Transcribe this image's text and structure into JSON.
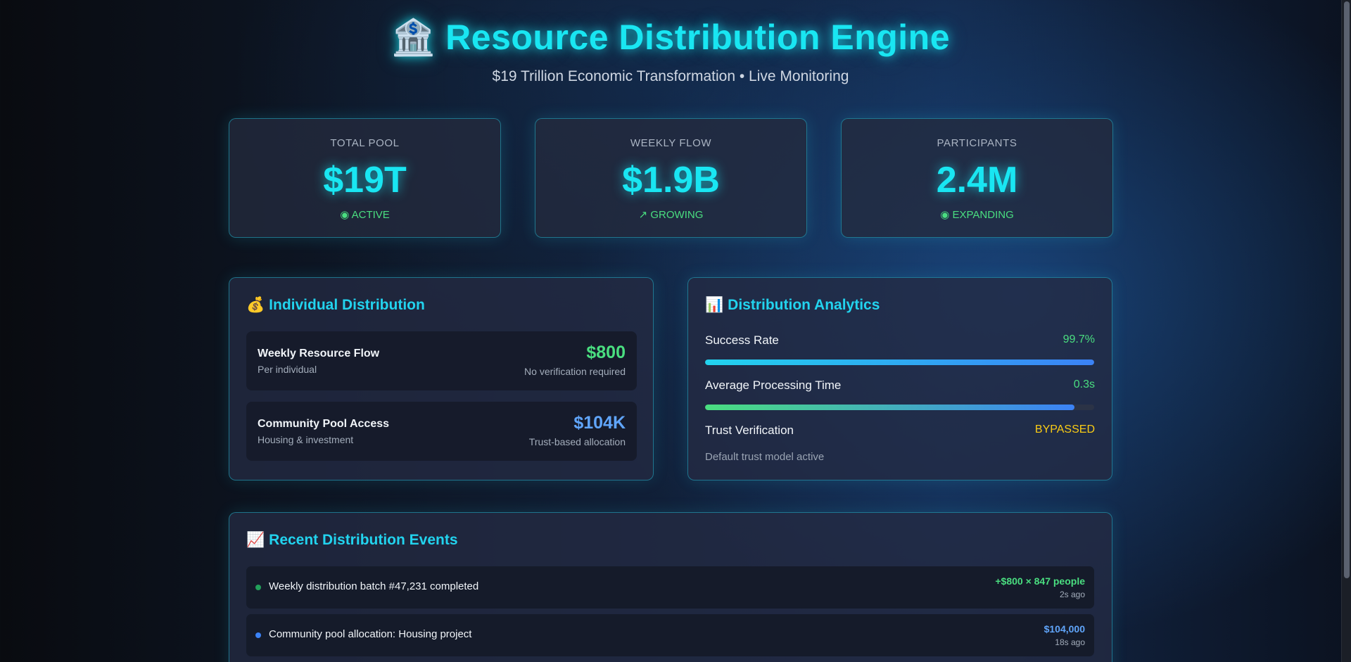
{
  "header": {
    "icon": "🏦",
    "title": "Resource Distribution Engine",
    "subtitle": "$19 Trillion Economic Transformation • Live Monitoring"
  },
  "stats": [
    {
      "label": "TOTAL POOL",
      "value": "$19T",
      "status_icon": "◉",
      "status": "ACTIVE"
    },
    {
      "label": "WEEKLY FLOW",
      "value": "$1.9B",
      "status_icon": "↗",
      "status": "GROWING"
    },
    {
      "label": "PARTICIPANTS",
      "value": "2.4M",
      "status_icon": "◉",
      "status": "EXPANDING"
    }
  ],
  "individual": {
    "icon": "💰",
    "title": "Individual Distribution",
    "rows": [
      {
        "name": "Weekly Resource Flow",
        "desc": "Per individual",
        "amount": "$800",
        "note": "No verification required",
        "color": "#4ade80"
      },
      {
        "name": "Community Pool Access",
        "desc": "Housing & investment",
        "amount": "$104K",
        "note": "Trust-based allocation",
        "color": "#60a5fa"
      }
    ]
  },
  "analytics": {
    "icon": "📊",
    "title": "Distribution Analytics",
    "metrics": [
      {
        "label": "Success Rate",
        "value": "99.7%",
        "color": "#4ade80",
        "level": 1.0
      },
      {
        "label": "Average Processing Time",
        "value": "0.3s",
        "color": "#4ade80",
        "level": 0.95
      },
      {
        "label": "Trust Verification",
        "value": "BYPASSED",
        "color": "#facc15"
      }
    ],
    "footnote": "Default trust model active"
  },
  "events": {
    "icon": "📈",
    "title": "Recent Distribution Events",
    "items": [
      {
        "text": "Weekly distribution batch #47,231 completed",
        "amount": "+$800 × 847 people",
        "ago": "2s ago",
        "color": "#4ade80",
        "dot": "#22a05a"
      },
      {
        "text": "Community pool allocation: Housing project",
        "amount": "$104,000",
        "ago": "18s ago",
        "color": "#60a5fa",
        "dot": "#3b82f6"
      }
    ]
  }
}
